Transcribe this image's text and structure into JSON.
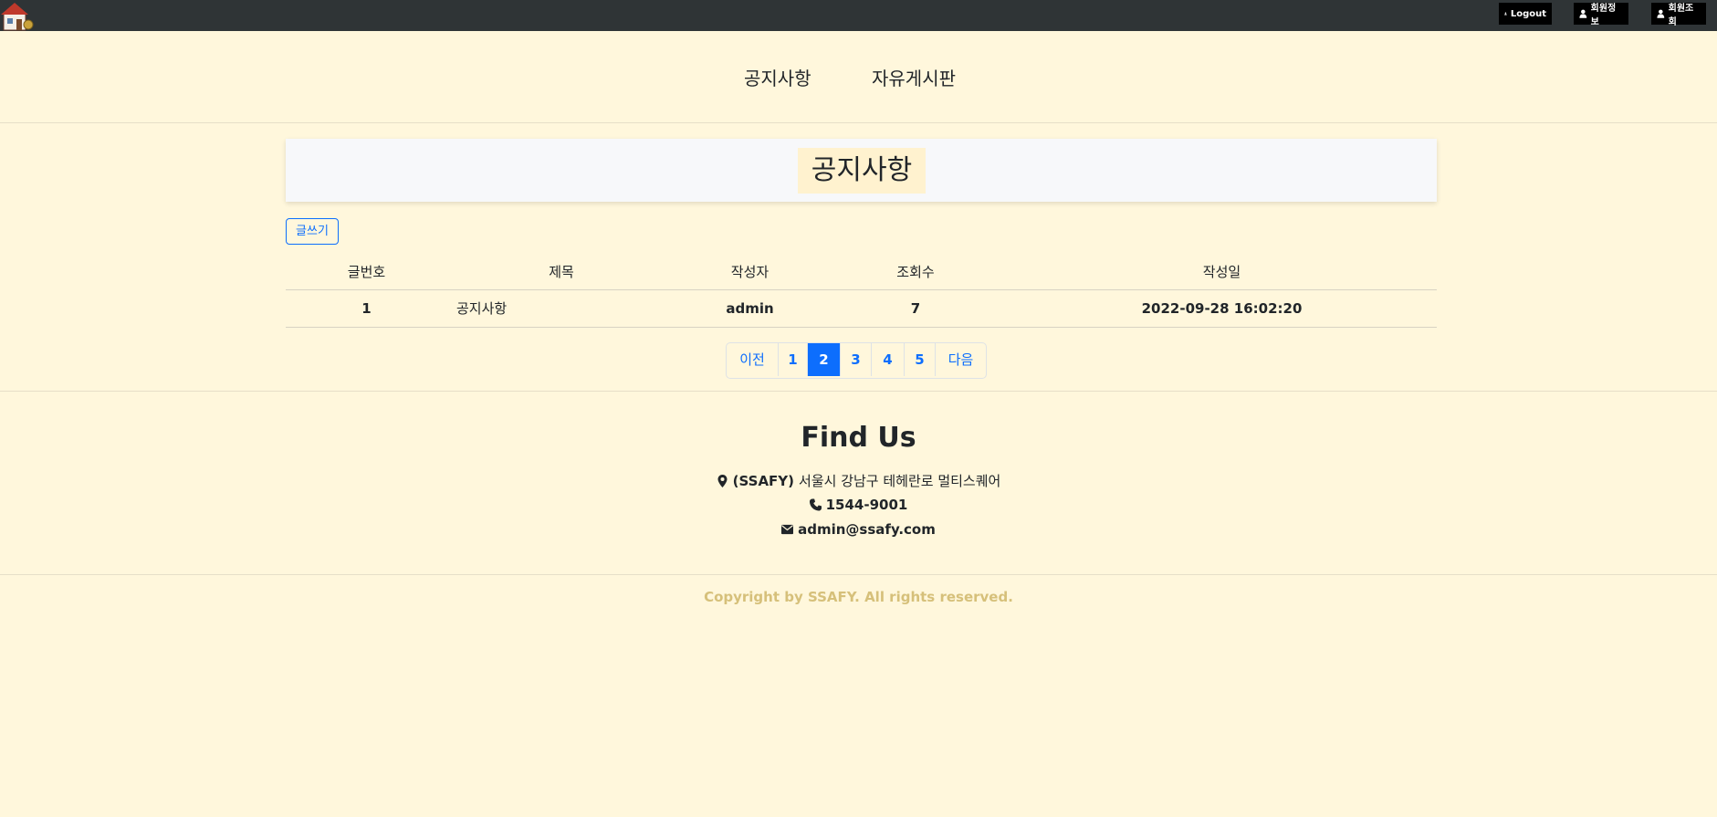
{
  "topbar": {
    "logout_label": "Logout",
    "member_info_label": "회원정보",
    "member_search_label": "회원조회"
  },
  "nav": {
    "notice": "공지사항",
    "free_board": "자유게시판"
  },
  "page_title": "공지사항",
  "write_button": "글쓰기",
  "table": {
    "headers": [
      "글번호",
      "제목",
      "작성자",
      "조회수",
      "작성일"
    ],
    "rows": [
      {
        "no": "1",
        "title": "공지사항",
        "author": "admin",
        "views": "7",
        "date": "2022-09-28 16:02:20"
      }
    ]
  },
  "pagination": {
    "prev": "이전",
    "pages": [
      "1",
      "2",
      "3",
      "4",
      "5"
    ],
    "active": "2",
    "next": "다음"
  },
  "footer": {
    "title": "Find Us",
    "address_bold": "(SSAFY)",
    "address": "서울시 강남구 테헤란로 멀티스퀘어",
    "phone": "1544-9001",
    "email": "admin@ssafy.com",
    "copyright": "Copyright by SSAFY. All rights reserved."
  },
  "colors": {
    "background": "#fff7dc",
    "topbar": "#2f3436",
    "accent": "#0d6efd",
    "copyright": "#d6c07a"
  },
  "icons": [
    "house-logo-icon",
    "user-icon",
    "map-marker-icon",
    "phone-icon",
    "envelope-icon"
  ]
}
